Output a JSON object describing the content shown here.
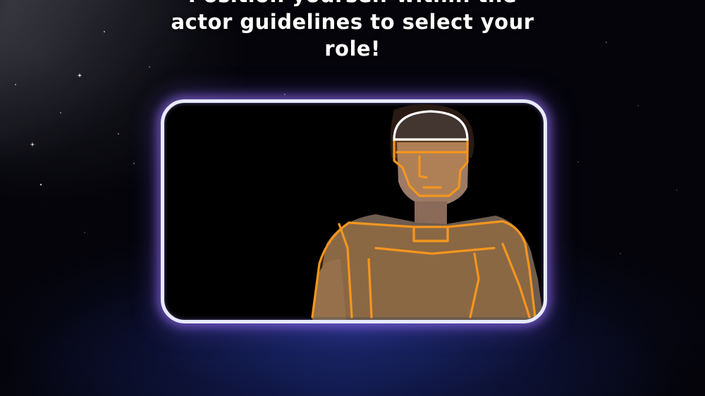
{
  "screen": {
    "instruction_lines": [
      "Position yourself within the",
      "actor guidelines to select your",
      "role!"
    ]
  },
  "camera": {
    "outline_color": "#f4961e",
    "head_outline_color": "#ffffff",
    "frame_color": "#e8eaff",
    "glow_color": "#a078ff"
  }
}
